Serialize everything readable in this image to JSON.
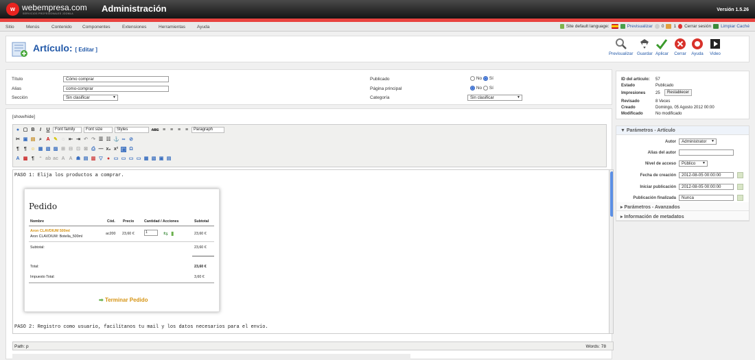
{
  "header": {
    "logo_mark": "w",
    "logo_text": "webempresa.com",
    "logo_sub": "SERVICIOS PROFESIONALES JOOMLA",
    "title": "Administración",
    "version": "Versión 1.5.26"
  },
  "menu": {
    "items": [
      "Sitio",
      "Menús",
      "Contenido",
      "Componentes",
      "Extensiones",
      "Herramientas",
      "Ayuda"
    ],
    "status": {
      "default_language": "Site default language:",
      "preview": "Previsualizar",
      "messages": "0",
      "users": "1",
      "logout": "Cerrar sesión",
      "clear_cache": "Limpiar Caché"
    }
  },
  "toolbar": {
    "title": "Artículo:",
    "subtitle": "[ Editar ]",
    "buttons": [
      "Previsualizar",
      "Guardar",
      "Aplicar",
      "Cerrar",
      "Ayuda",
      "Video"
    ]
  },
  "form": {
    "titulo_label": "Título",
    "titulo_value": "Cómo comprar",
    "alias_label": "Alias",
    "alias_value": "como-comprar",
    "seccion_label": "Sección",
    "seccion_value": "Sin clasificar",
    "publicado_label": "Publicado",
    "pagina_label": "Página principal",
    "categoria_label": "Categoría",
    "categoria_value": "Sin clasificar",
    "no": "No",
    "si": "Sí",
    "publicado_selected": "Sí",
    "pagina_selected": "No"
  },
  "editor": {
    "showhide": "[show/hide]",
    "font_family": "Font family",
    "font_size": "Font size",
    "styles": "Styles",
    "paragraph": "Paragraph",
    "step1": "PASO 1: Elija los productos a comprar.",
    "step2": "PASO 2: Registro como usuario, facilítanos tu mail y los datos necesarios para el envío.",
    "path": "Path: p",
    "words": "Words: 78"
  },
  "pedido": {
    "title": "Pedido",
    "headers": [
      "Nombre",
      "Cód.",
      "Precio",
      "Cantidad / Acciones",
      "Subtotal"
    ],
    "product_name": "Aron CLAVDIUM 500ml",
    "product_sub": "Aron CLAVDIUM: Botella_500ml",
    "code": "ac200",
    "price": "23,60 €",
    "qty": "1",
    "subtotal": "23,60 €",
    "subtotal_label": "Subtotal:",
    "subtotal_value": "23,60 €",
    "total_label": "Total:",
    "total_value": "23,60 €",
    "tax_label": "Impuesto Total:",
    "tax_value": "3,60 €",
    "button": "Terminar Pedido"
  },
  "info": {
    "id_label": "ID del artículo:",
    "id_value": "57",
    "estado_label": "Estado",
    "estado_value": "Publicado",
    "impresiones_label": "Impresiones",
    "impresiones_value": "25",
    "restablecer": "Restablecer",
    "revisado_label": "Revisado",
    "revisado_value": "8 Veces",
    "creado_label": "Creado",
    "creado_value": "Domingo, 05 Agosto 2012 00:00",
    "modificado_label": "Modificado",
    "modificado_value": "No modificado"
  },
  "params": {
    "title": "Parámetros - Artículo",
    "autor_label": "Autor",
    "autor_value": "Administrator",
    "alias_autor_label": "Alias del autor",
    "nivel_label": "Nivel de acceso",
    "nivel_value": "Público",
    "fecha_creacion_label": "Fecha de creación",
    "fecha_creacion_value": "2012-08-05 00:00:00",
    "iniciar_label": "Iniciar publicación",
    "iniciar_value": "2012-08-05 00:00:00",
    "finalizada_label": "Publicación finalizada",
    "finalizada_value": "Nunca",
    "avanzados": "Parámetros - Avanzados",
    "metadatos": "Información de metadatos"
  },
  "colors": {
    "brand_red": "#e8231f",
    "link_blue": "#2158a8",
    "accent_orange": "#d69414"
  }
}
